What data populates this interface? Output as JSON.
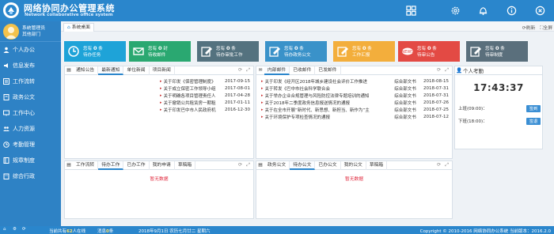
{
  "header": {
    "title": "网络协同办公管理系统",
    "subtitle": "Network collaborative office system",
    "icons": [
      "grid-icon",
      "gear-icon",
      "bell-icon",
      "info-icon",
      "close-icon"
    ]
  },
  "sidebar": {
    "user_line1": "系统管理员",
    "user_line2": "其他部门",
    "items": [
      {
        "label": "个人办公",
        "icon": "person-icon"
      },
      {
        "label": "信息发布",
        "icon": "speaker-icon"
      },
      {
        "label": "工作流转",
        "icon": "flow-icon"
      },
      {
        "label": "政务公文",
        "icon": "doc-icon"
      },
      {
        "label": "工作中心",
        "icon": "monitor-icon"
      },
      {
        "label": "人力资源",
        "icon": "people-icon"
      },
      {
        "label": "考勤管理",
        "icon": "clock-icon"
      },
      {
        "label": "规章制度",
        "icon": "book-icon"
      },
      {
        "label": "综合行政",
        "icon": "building-icon"
      }
    ]
  },
  "tabbar": {
    "home_tab": "系统桌面",
    "refresh": "刷新",
    "fullscreen": "全屏"
  },
  "tiles": [
    {
      "prefix": "您有",
      "count": "0",
      "unit": "条",
      "label": "待办任务",
      "color": "#1ea3d8",
      "icon": "clock-icon"
    },
    {
      "prefix": "您有",
      "count": "0",
      "unit": "封",
      "label": "待收邮件",
      "color": "#2aa871",
      "icon": "mail-icon"
    },
    {
      "prefix": "您有",
      "count": "0",
      "unit": "条",
      "label": "待办审批工作",
      "color": "#54727f",
      "icon": "edit-icon"
    },
    {
      "prefix": "您有",
      "count": "0",
      "unit": "条",
      "label": "待办政务公文",
      "color": "#3a92c9",
      "icon": "edit-icon"
    },
    {
      "prefix": "您有",
      "count": "0",
      "unit": "条",
      "label": "工作汇报",
      "color": "#f3ae3c",
      "icon": "edit-icon"
    },
    {
      "prefix": "您有",
      "count": "0",
      "unit": "条",
      "label": "待审公告",
      "color": "#e34a44",
      "icon": "news-icon"
    },
    {
      "prefix": "您有",
      "count": "0",
      "unit": "条",
      "label": "待审制度",
      "color": "#5a6f7c",
      "icon": "edit-icon"
    }
  ],
  "notices": {
    "tabs": [
      "通知公告",
      "最新通知",
      "单位新闻",
      "项目新闻"
    ],
    "active_tab": 1,
    "rows": [
      {
        "title": "关于印发《保密管理制度》",
        "date": "2017-09-15"
      },
      {
        "title": "关于成立保密工作领导小组",
        "date": "2017-08-01"
      },
      {
        "title": "关于明确各项目管理责任人",
        "date": "2017-04-28"
      },
      {
        "title": "关于撤销公共租赁房一期租",
        "date": "2017-01-11"
      },
      {
        "title": "关于印发巴中市人民政府机",
        "date": "2016-12-30"
      }
    ]
  },
  "mail": {
    "tabs": [
      "内部邮件",
      "已收邮件",
      "已发邮件"
    ],
    "active_tab": 0,
    "rows": [
      {
        "title": "关于印发《经开区2018年城乡建设社会评价工作推进",
        "dept": "综合部文书",
        "date": "2018-08-15"
      },
      {
        "title": "关于转发《巴中市社会科学联合会",
        "dept": "综合部文书",
        "date": "2018-07-31"
      },
      {
        "title": "关于举办企业合规管理与风险防控法律专题培训的通知",
        "dept": "综合部文书",
        "date": "2018-07-31"
      },
      {
        "title": "关于2018年二季度政务信息报送情况的通报",
        "dept": "综合部文书",
        "date": "2018-07-26"
      },
      {
        "title": "关于在全市开展“新时代、新思想、新担当、新作为”主",
        "dept": "综合部文书",
        "date": "2018-07-25"
      },
      {
        "title": "关于环境保护专项检查情况的通报",
        "dept": "综合部文书",
        "date": "2018-07-12"
      }
    ]
  },
  "attendance": {
    "title": "个人考勤",
    "time": "17:43:37",
    "rows": [
      {
        "label": "上班(09:00)：",
        "button": "签到"
      },
      {
        "label": "下班(18:00)：",
        "button": "签退"
      }
    ]
  },
  "workflow": {
    "tabs": [
      "工作流转",
      "待办工作",
      "已办工作",
      "我的申请",
      "草稿箱"
    ],
    "active_tab": 1,
    "empty": "暂无数据"
  },
  "docs": {
    "tabs": [
      "政务公文",
      "待办公文",
      "已办公文",
      "我的公文",
      "草稿箱"
    ],
    "active_tab": 1,
    "empty": "暂无数据"
  },
  "footer": {
    "online_prefix": "当前共有",
    "online_count": "62",
    "online_suffix": "人在线",
    "msg_prefix": "消息",
    "msg_count": "0",
    "msg_suffix": "条",
    "date": "2018年9月1日 农历七月廿二 星期六",
    "copyright": "Copyright © 2010-2016 网络协同办公系统 当前版本：2016.2.0"
  }
}
